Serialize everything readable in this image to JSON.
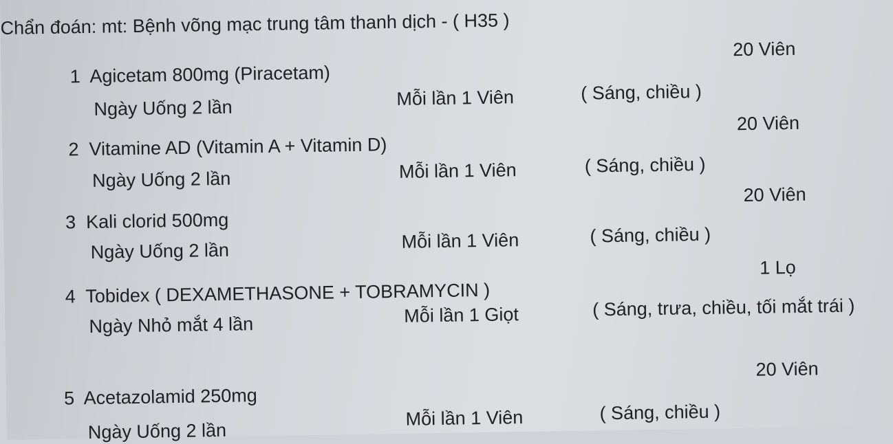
{
  "diagnosis": "Chẩn đoán:  mt: Bệnh võng mạc trung tâm thanh dịch - ( H35 )",
  "items": [
    {
      "num": "1",
      "name": "Agicetam 800mg (Piracetam)",
      "quantity": "20  Viên",
      "usage": "Ngày Uống 2 lần",
      "dose": "Mỗi lần 1 Viên",
      "time": "( Sáng, chiều )"
    },
    {
      "num": "2",
      "name": "Vitamine AD (Vitamin A + Vitamin D)",
      "quantity": "20  Viên",
      "usage": "Ngày Uống 2 lần",
      "dose": "Mỗi lần 1 Viên",
      "time": "( Sáng, chiều )"
    },
    {
      "num": "3",
      "name": "Kali clorid 500mg",
      "quantity": "20  Viên",
      "usage": "Ngày Uống 2 lần",
      "dose": "Mỗi lần 1 Viên",
      "time": "( Sáng, chiều )"
    },
    {
      "num": "4",
      "name": "Tobidex ( DEXAMETHASONE + TOBRAMYCIN )",
      "quantity": "1  Lọ",
      "usage": "Ngày Nhỏ mắt 4 lần",
      "dose": "Mỗi lần 1 Giọt",
      "time": "( Sáng, trưa, chiều, tối mắt trái )"
    },
    {
      "num": "5",
      "name": "Acetazolamid 250mg",
      "quantity": "20  Viên",
      "usage": "Ngày Uống 2 lần",
      "dose": "Mỗi lần 1 Viên",
      "time": "( Sáng, chiều )"
    }
  ]
}
